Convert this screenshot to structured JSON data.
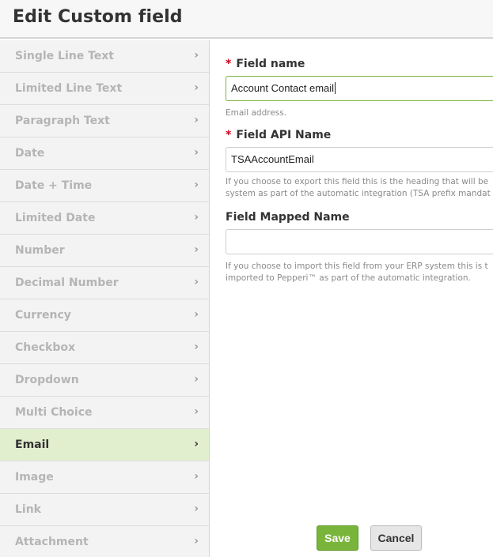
{
  "header": {
    "title": "Edit Custom field"
  },
  "sidebar": {
    "items": [
      {
        "label": "Single Line Text",
        "name": "single-line-text",
        "active": false
      },
      {
        "label": "Limited Line Text",
        "name": "limited-line-text",
        "active": false
      },
      {
        "label": "Paragraph Text",
        "name": "paragraph-text",
        "active": false
      },
      {
        "label": "Date",
        "name": "date",
        "active": false
      },
      {
        "label": "Date + Time",
        "name": "date-time",
        "active": false
      },
      {
        "label": "Limited Date",
        "name": "limited-date",
        "active": false
      },
      {
        "label": "Number",
        "name": "number",
        "active": false
      },
      {
        "label": "Decimal Number",
        "name": "decimal-number",
        "active": false
      },
      {
        "label": "Currency",
        "name": "currency",
        "active": false
      },
      {
        "label": "Checkbox",
        "name": "checkbox",
        "active": false
      },
      {
        "label": "Dropdown",
        "name": "dropdown",
        "active": false
      },
      {
        "label": "Multi Choice",
        "name": "multi-choice",
        "active": false
      },
      {
        "label": "Email",
        "name": "email",
        "active": true
      },
      {
        "label": "Image",
        "name": "image",
        "active": false
      },
      {
        "label": "Link",
        "name": "link",
        "active": false
      },
      {
        "label": "Attachment",
        "name": "attachment",
        "active": false
      }
    ],
    "chevron": "›"
  },
  "form": {
    "required_marker": "*",
    "field_name": {
      "label": "Field name",
      "value": "Account Contact email",
      "help": "Email address."
    },
    "api_name": {
      "label": "Field API Name",
      "value": "TSAAccountEmail",
      "help_line1": "If you choose to export this field this is the heading that will be",
      "help_line2": "system as part of the automatic integration (TSA prefix mandat"
    },
    "mapped_name": {
      "label": "Field Mapped Name",
      "value": "",
      "help_line1": "If you choose to import this field from your ERP system this is t",
      "help_line2": "imported to Pepperi™ as part of the automatic integration."
    }
  },
  "buttons": {
    "save": "Save",
    "cancel": "Cancel"
  },
  "colors": {
    "accent": "#7ab53b",
    "active_bg": "#e2efcf",
    "required": "#d0021b"
  }
}
